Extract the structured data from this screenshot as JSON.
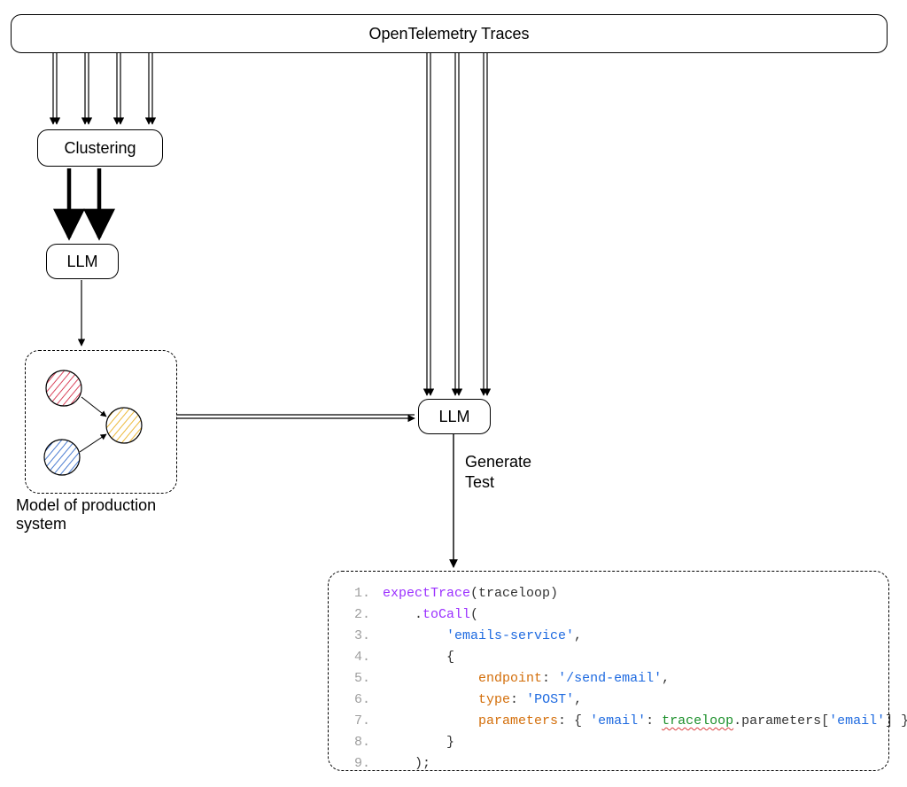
{
  "nodes": {
    "traces": "OpenTelemetry Traces",
    "clustering": "Clustering",
    "llm1": "LLM",
    "llm2": "LLM"
  },
  "captions": {
    "model": "Model of production system",
    "generate_test_line1": "Generate",
    "generate_test_line2": "Test"
  },
  "code": {
    "lines": [
      {
        "num": "1.",
        "segments": [
          {
            "cls": "c-purple",
            "text": "expectTrace"
          },
          {
            "cls": "c-default",
            "text": "(traceloop)"
          }
        ]
      },
      {
        "num": "2.",
        "segments": [
          {
            "cls": "c-default",
            "text": "    ."
          },
          {
            "cls": "c-purple",
            "text": "toCall"
          },
          {
            "cls": "c-default",
            "text": "("
          }
        ]
      },
      {
        "num": "3.",
        "segments": [
          {
            "cls": "c-default",
            "text": "        "
          },
          {
            "cls": "c-string",
            "text": "'emails-service'"
          },
          {
            "cls": "c-default",
            "text": ","
          }
        ]
      },
      {
        "num": "4.",
        "segments": [
          {
            "cls": "c-default",
            "text": "        {"
          }
        ]
      },
      {
        "num": "5.",
        "segments": [
          {
            "cls": "c-default",
            "text": "            "
          },
          {
            "cls": "c-key",
            "text": "endpoint"
          },
          {
            "cls": "c-default",
            "text": ": "
          },
          {
            "cls": "c-string",
            "text": "'/send-email'"
          },
          {
            "cls": "c-default",
            "text": ","
          }
        ]
      },
      {
        "num": "6.",
        "segments": [
          {
            "cls": "c-default",
            "text": "            "
          },
          {
            "cls": "c-key",
            "text": "type"
          },
          {
            "cls": "c-default",
            "text": ": "
          },
          {
            "cls": "c-string",
            "text": "'POST'"
          },
          {
            "cls": "c-default",
            "text": ","
          }
        ]
      },
      {
        "num": "7.",
        "segments": [
          {
            "cls": "c-default",
            "text": "            "
          },
          {
            "cls": "c-key",
            "text": "parameters"
          },
          {
            "cls": "c-default",
            "text": ": { "
          },
          {
            "cls": "c-string",
            "text": "'email'"
          },
          {
            "cls": "c-default",
            "text": ": "
          },
          {
            "cls": "c-green squiggle",
            "text": "traceloop"
          },
          {
            "cls": "c-default",
            "text": ".parameters["
          },
          {
            "cls": "c-string",
            "text": "'email'"
          },
          {
            "cls": "c-default",
            "text": "] }"
          }
        ]
      },
      {
        "num": "8.",
        "segments": [
          {
            "cls": "c-default",
            "text": "        }"
          }
        ]
      },
      {
        "num": "9.",
        "segments": [
          {
            "cls": "c-default",
            "text": "    );"
          }
        ]
      }
    ]
  },
  "model_graph": {
    "nodes": [
      {
        "color": "#d9445c",
        "label": "red-node"
      },
      {
        "color": "#ecb93a",
        "label": "yellow-node"
      },
      {
        "color": "#4b7cd1",
        "label": "blue-node"
      }
    ]
  }
}
